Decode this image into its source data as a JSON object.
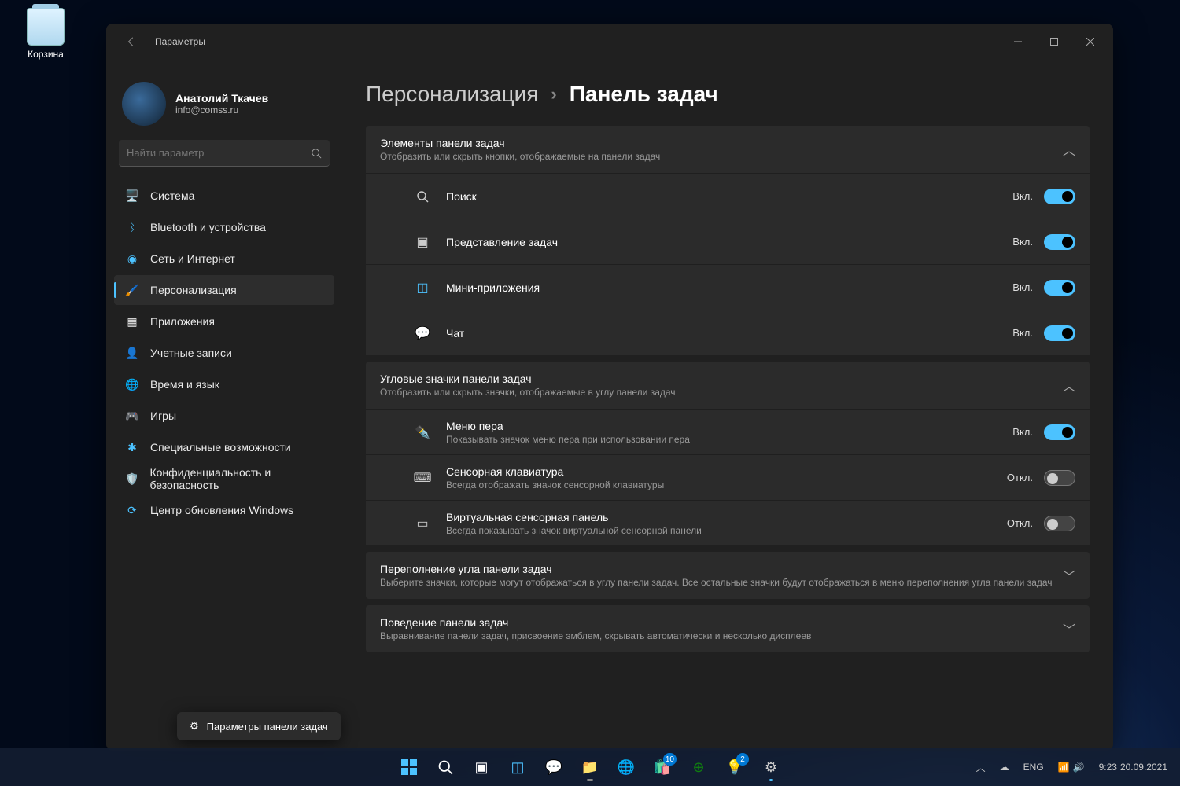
{
  "desktop": {
    "recycle_bin": "Корзина"
  },
  "window": {
    "title": "Параметры",
    "user": {
      "name": "Анатолий Ткачев",
      "email": "info@comss.ru"
    },
    "search_placeholder": "Найти параметр",
    "nav": {
      "system": "Система",
      "bluetooth": "Bluetooth и устройства",
      "network": "Сеть и Интернет",
      "personalization": "Персонализация",
      "apps": "Приложения",
      "accounts": "Учетные записи",
      "time": "Время и язык",
      "gaming": "Игры",
      "accessibility": "Специальные возможности",
      "privacy": "Конфиденциальность и безопасность",
      "update": "Центр обновления Windows"
    },
    "breadcrumb": {
      "parent": "Персонализация",
      "current": "Панель задач"
    },
    "section1": {
      "title": "Элементы панели задач",
      "subtitle": "Отобразить или скрыть кнопки, отображаемые на панели задач",
      "items": [
        {
          "label": "Поиск",
          "state": "Вкл.",
          "on": true
        },
        {
          "label": "Представление задач",
          "state": "Вкл.",
          "on": true
        },
        {
          "label": "Мини-приложения",
          "state": "Вкл.",
          "on": true
        },
        {
          "label": "Чат",
          "state": "Вкл.",
          "on": true
        }
      ]
    },
    "section2": {
      "title": "Угловые значки панели задач",
      "subtitle": "Отобразить или скрыть значки, отображаемые в углу панели задач",
      "items": [
        {
          "label": "Меню пера",
          "sub": "Показывать значок меню пера при использовании пера",
          "state": "Вкл.",
          "on": true
        },
        {
          "label": "Сенсорная клавиатура",
          "sub": "Всегда отображать значок сенсорной клавиатуры",
          "state": "Откл.",
          "on": false
        },
        {
          "label": "Виртуальная сенсорная панель",
          "sub": "Всегда показывать значок виртуальной сенсорной панели",
          "state": "Откл.",
          "on": false
        }
      ]
    },
    "section3": {
      "title": "Переполнение угла панели задач",
      "subtitle": "Выберите значки, которые могут отображаться в углу панели задач. Все остальные значки будут отображаться в меню переполнения угла панели задач"
    },
    "section4": {
      "title": "Поведение панели задач",
      "subtitle": "Выравнивание панели задач, присвоение эмблем, скрывать автоматически и несколько дисплеев"
    }
  },
  "tooltip": "Параметры панели задач",
  "taskbar": {
    "badge_store": "10",
    "badge_tips": "2",
    "tray": {
      "lang": "ENG",
      "sound_icon": "🔊",
      "time": "9:23",
      "date": "20.09.2021"
    }
  }
}
